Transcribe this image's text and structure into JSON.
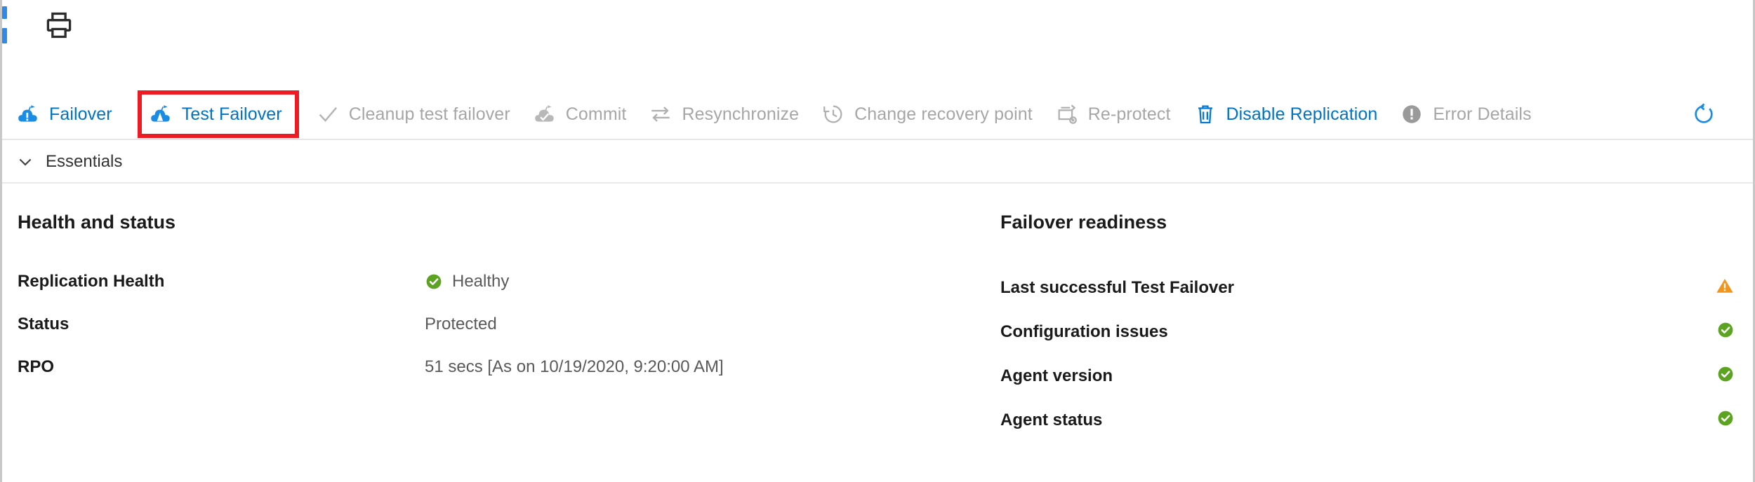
{
  "topbar": {
    "print_icon": "print-icon"
  },
  "toolbar": {
    "commands": [
      {
        "label": "Failover",
        "icon": "cloud-failover-icon",
        "enabled": true,
        "highlighted": false
      },
      {
        "label": "Test Failover",
        "icon": "cloud-test-failover-icon",
        "enabled": true,
        "highlighted": true
      },
      {
        "label": "Cleanup test failover",
        "icon": "checkmark-icon",
        "enabled": false,
        "highlighted": false
      },
      {
        "label": "Commit",
        "icon": "cloud-commit-icon",
        "enabled": false,
        "highlighted": false
      },
      {
        "label": "Resynchronize",
        "icon": "resynchronize-icon",
        "enabled": false,
        "highlighted": false
      },
      {
        "label": "Change recovery point",
        "icon": "clock-history-icon",
        "enabled": false,
        "highlighted": false
      },
      {
        "label": "Re-protect",
        "icon": "re-protect-icon",
        "enabled": false,
        "highlighted": false
      },
      {
        "label": "Disable Replication",
        "icon": "trash-icon",
        "enabled": true,
        "highlighted": false
      },
      {
        "label": "Error Details",
        "icon": "error-exclamation-icon",
        "enabled": false,
        "highlighted": false
      }
    ],
    "refresh": {
      "label": "",
      "icon": "refresh-icon"
    },
    "highlight_color": "#ed1c24",
    "enabled_color": "#0072c6",
    "disabled_color": "#a6a6a6"
  },
  "essentials": {
    "label": "Essentials",
    "chevron": "chevron-down-icon",
    "expanded": true
  },
  "health_and_status": {
    "title": "Health and status",
    "rows": [
      {
        "label": "Replication Health",
        "value": "Healthy",
        "status_icon": "green-check-icon"
      },
      {
        "label": "Status",
        "value": "Protected",
        "status_icon": ""
      },
      {
        "label": "RPO",
        "value": "51 secs [As on 10/19/2020, 9:20:00 AM]",
        "status_icon": ""
      }
    ]
  },
  "failover_readiness": {
    "title": "Failover readiness",
    "rows": [
      {
        "label": "Last successful Test Failover",
        "status_icon": "orange-warning-icon"
      },
      {
        "label": "Configuration issues",
        "status_icon": "green-check-icon"
      },
      {
        "label": "Agent version",
        "status_icon": "green-check-icon"
      },
      {
        "label": "Agent status",
        "status_icon": "green-check-icon"
      }
    ]
  },
  "colors": {
    "healthy_green": "#5ba320",
    "warning_orange": "#f0951e",
    "link_blue": "#0072c6",
    "highlight_red": "#ed1c24"
  }
}
